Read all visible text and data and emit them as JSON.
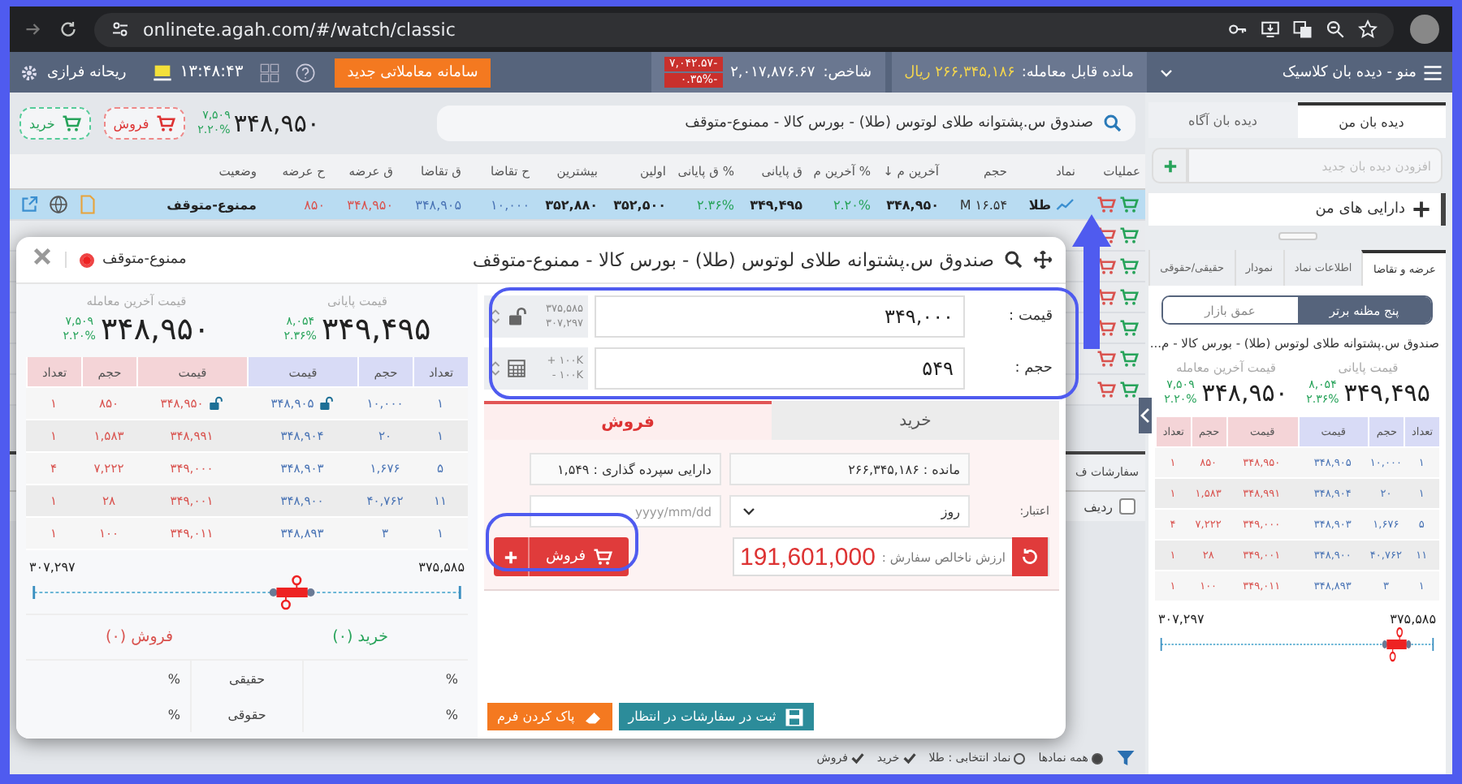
{
  "browser": {
    "url": "onlinete.agah.com/#/watch/classic"
  },
  "app_bar": {
    "menu": "منو - دیده بان کلاسیک",
    "balance_label": "مانده قابل معامله:",
    "balance": "۲۶۶,۳۴۵,۱۸۶ ریال",
    "index_label": "شاخص:",
    "index_value": "۲,۰۱۷,۸۷۶.۶۷",
    "index_change": "-۷,۰۴۲.۵۷",
    "index_percent": "-۰.۳۵%",
    "new_system_button": "سامانه معاملاتی جدید",
    "clock": "۱۳:۴۸:۴۳",
    "user": "ریحانه فرازی"
  },
  "toolbar": {
    "search_value": "صندوق س.پشتوانه طلای لوتوس (طلا) - بورس کالا - ممنوع-متوقف",
    "last_price": "۳۴۸,۹۵۰",
    "change": "۷,۵۰۹",
    "change_percent": "۲.۲۰%",
    "sell_button": "فروش",
    "buy_button": "خرید"
  },
  "table": {
    "columns": [
      "عملیات",
      "نماد",
      "حجم",
      "آخرین م ↓",
      "% آخرین م",
      "ق پایانی",
      "% ق پایانی",
      "اولین",
      "بیشترین",
      "ح تقاضا",
      "ق تقاضا",
      "ق عرضه",
      "ح عرضه",
      "وضعیت"
    ],
    "rows": [
      {
        "selected": true,
        "cells": [
          "طلا",
          "۱۶.۵۴ M",
          "۳۴۸,۹۵۰",
          "۲.۲۰%",
          "۳۴۹,۴۹۵",
          "۲.۳۶%",
          "۳۵۲,۵۰۰",
          "۳۵۲,۸۸۰",
          "۱۰,۰۰۰",
          "۳۴۸,۹۰۵",
          "۳۴۸,۹۵۰",
          "۸۵۰",
          "ممنوع-متوقف"
        ]
      },
      {
        "selected": false
      },
      {
        "selected": false
      },
      {
        "selected": false
      },
      {
        "selected": false
      },
      {
        "selected": false
      },
      {
        "selected": false
      }
    ]
  },
  "orders_panel": {
    "title": "سفارشات ف",
    "column": "ردیف",
    "checked": false
  },
  "filter_bar": [
    {
      "label": "همه نمادها",
      "kind": "radio",
      "checked": true
    },
    {
      "label": "نماد انتخابی : طلا",
      "kind": "radio",
      "checked": false
    },
    {
      "label": "خرید",
      "kind": "check",
      "checked": true
    },
    {
      "label": "فروش",
      "kind": "check",
      "checked": true
    }
  ],
  "order_dialog": {
    "title": "صندوق س.پشتوانه طلای لوتوس (طلا) - بورس کالا - ممنوع-متوقف",
    "status": "ممنوع-متوقف",
    "summary": [
      {
        "label": "قیمت پایانی",
        "value": "۳۴۹,۴۹۵",
        "change": "۸,۰۵۴",
        "change_percent": "۲.۳۶%"
      },
      {
        "label": "قیمت آخرین معامله",
        "value": "۳۴۸,۹۵۰",
        "change": "۷,۵۰۹",
        "change_percent": "۲.۲۰%"
      }
    ],
    "order_book": {
      "columns": [
        "تعداد",
        "حجم",
        "قیمت",
        "قیمت",
        "حجم",
        "تعداد"
      ],
      "rows": [
        {
          "bid_count": "۱",
          "bid_volume": "۱۰,۰۰۰",
          "bid_price": "۳۴۸,۹۰۵",
          "bid_locked": true,
          "ask_price": "۳۴۸,۹۵۰",
          "ask_locked": true,
          "ask_volume": "۸۵۰",
          "ask_count": "۱"
        },
        {
          "bid_count": "۱",
          "bid_volume": "۲۰",
          "bid_price": "۳۴۸,۹۰۴",
          "ask_price": "۳۴۸,۹۹۱",
          "ask_volume": "۱,۵۸۳",
          "ask_count": "۱"
        },
        {
          "bid_count": "۵",
          "bid_volume": "۱,۶۷۶",
          "bid_price": "۳۴۸,۹۰۳",
          "ask_price": "۳۴۹,۰۰۰",
          "ask_volume": "۷,۲۲۲",
          "ask_count": "۴"
        },
        {
          "bid_count": "۱۱",
          "bid_volume": "۴۰,۷۶۲",
          "bid_price": "۳۴۸,۹۰۰",
          "ask_price": "۳۴۹,۰۰۱",
          "ask_volume": "۲۸",
          "ask_count": "۱"
        },
        {
          "bid_count": "۱",
          "bid_volume": "۳",
          "bid_price": "۳۴۸,۸۹۳",
          "ask_price": "۳۴۹,۰۱۱",
          "ask_volume": "۱۰۰",
          "ask_count": "۱"
        }
      ]
    },
    "range": {
      "min": "۳۰۷,۲۹۷",
      "max": "۳۷۵,۵۸۵",
      "level": 0.61
    },
    "buy_count": "خرید (۰)",
    "sell_count": "فروش (۰)",
    "investors": [
      {
        "label": "حقیقی",
        "buy": "%",
        "sell": "%"
      },
      {
        "label": "حقوقی",
        "buy": "%",
        "sell": "%"
      }
    ],
    "form": {
      "price_label": "قیمت :",
      "price": "۳۴۹,۰۰۰",
      "price_max": "۳۷۵,۵۸۵",
      "price_min": "۳۰۷,۲۹۷",
      "price_locked": true,
      "volume_label": "حجم :",
      "volume": "۵۴۹",
      "volume_up": "+ ۱۰۰K",
      "volume_down": "- ۱۰۰K",
      "sides": [
        {
          "label": "خرید",
          "kind": "buy",
          "selected": false
        },
        {
          "label": "فروش",
          "kind": "sell",
          "selected": true
        }
      ],
      "remaining": "مانده : ۲۶۶,۳۴۵,۱۸۶",
      "holding": "دارایی سپرده گذاری : ۱,۵۴۹",
      "validity_label": "اعتبار:",
      "validity": "روز",
      "date_placeholder": "yyyy/mm/dd",
      "value_label": "ارزش ناخالص سفارش :",
      "value": "191,601,000",
      "submit": "فروش"
    },
    "footer": {
      "pending": "ثبت در سفارشات در انتظار",
      "clear": "پاک کردن فرم"
    }
  },
  "right_panel": {
    "watch_tabs": [
      {
        "label": "دیده بان من",
        "selected": true
      },
      {
        "label": "دیده بان آگاه",
        "selected": false
      }
    ],
    "add_placeholder": "افزودن دیده بان جدید",
    "groups": [
      {
        "label": "دارایی های من",
        "expanded": false
      }
    ],
    "info_tabs": [
      {
        "label": "عرضه و تقاضا",
        "selected": true
      },
      {
        "label": "اطلاعات نماد",
        "selected": false
      },
      {
        "label": "نمودار",
        "selected": false
      },
      {
        "label": "حقیقی/حقوقی",
        "selected": false
      }
    ],
    "view_toggle": [
      {
        "label": "پنج مظنه برتر",
        "selected": true
      },
      {
        "label": "عمق بازار",
        "selected": false
      }
    ],
    "title": "صندوق س.پشتوانه طلای لوتوس (طلا) - بورس کالا - م...",
    "summary": [
      {
        "label": "قیمت پایانی",
        "value": "۳۴۹,۴۹۵",
        "change": "۸,۰۵۴",
        "change_percent": "۲.۳۶%"
      },
      {
        "label": "قیمت آخرین معامله",
        "value": "۳۴۸,۹۵۰",
        "change": "۷,۵۰۹",
        "change_percent": "۲.۲۰%"
      }
    ],
    "order_book": {
      "columns": [
        "تعداد",
        "حجم",
        "قیمت",
        "قیمت",
        "حجم",
        "تعداد"
      ],
      "rows": [
        {
          "bid_count": "۱",
          "bid_volume": "۱۰,۰۰۰",
          "bid_price": "۳۴۸,۹۰۵",
          "ask_price": "۳۴۸,۹۵۰",
          "ask_volume": "۸۵۰",
          "ask_count": "۱"
        },
        {
          "bid_count": "۱",
          "bid_volume": "۲۰",
          "bid_price": "۳۴۸,۹۰۴",
          "ask_price": "۳۴۸,۹۹۱",
          "ask_volume": "۱,۵۸۳",
          "ask_count": "۱"
        },
        {
          "bid_count": "۵",
          "bid_volume": "۱,۶۷۶",
          "bid_price": "۳۴۸,۹۰۳",
          "ask_price": "۳۴۹,۰۰۰",
          "ask_volume": "۷,۲۲۲",
          "ask_count": "۴"
        },
        {
          "bid_count": "۱۱",
          "bid_volume": "۴۰,۷۶۲",
          "bid_price": "۳۴۸,۹۰۰",
          "ask_price": "۳۴۹,۰۰۱",
          "ask_volume": "۲۸",
          "ask_count": "۱"
        },
        {
          "bid_count": "۱",
          "bid_volume": "۳",
          "bid_price": "۳۴۸,۸۹۳",
          "ask_price": "۳۴۹,۰۱۱",
          "ask_volume": "۱۰۰",
          "ask_count": "۱"
        }
      ]
    },
    "range": {
      "min": "۳۰۷,۲۹۷",
      "max": "۳۷۵,۵۸۵",
      "level": 0.88
    }
  }
}
